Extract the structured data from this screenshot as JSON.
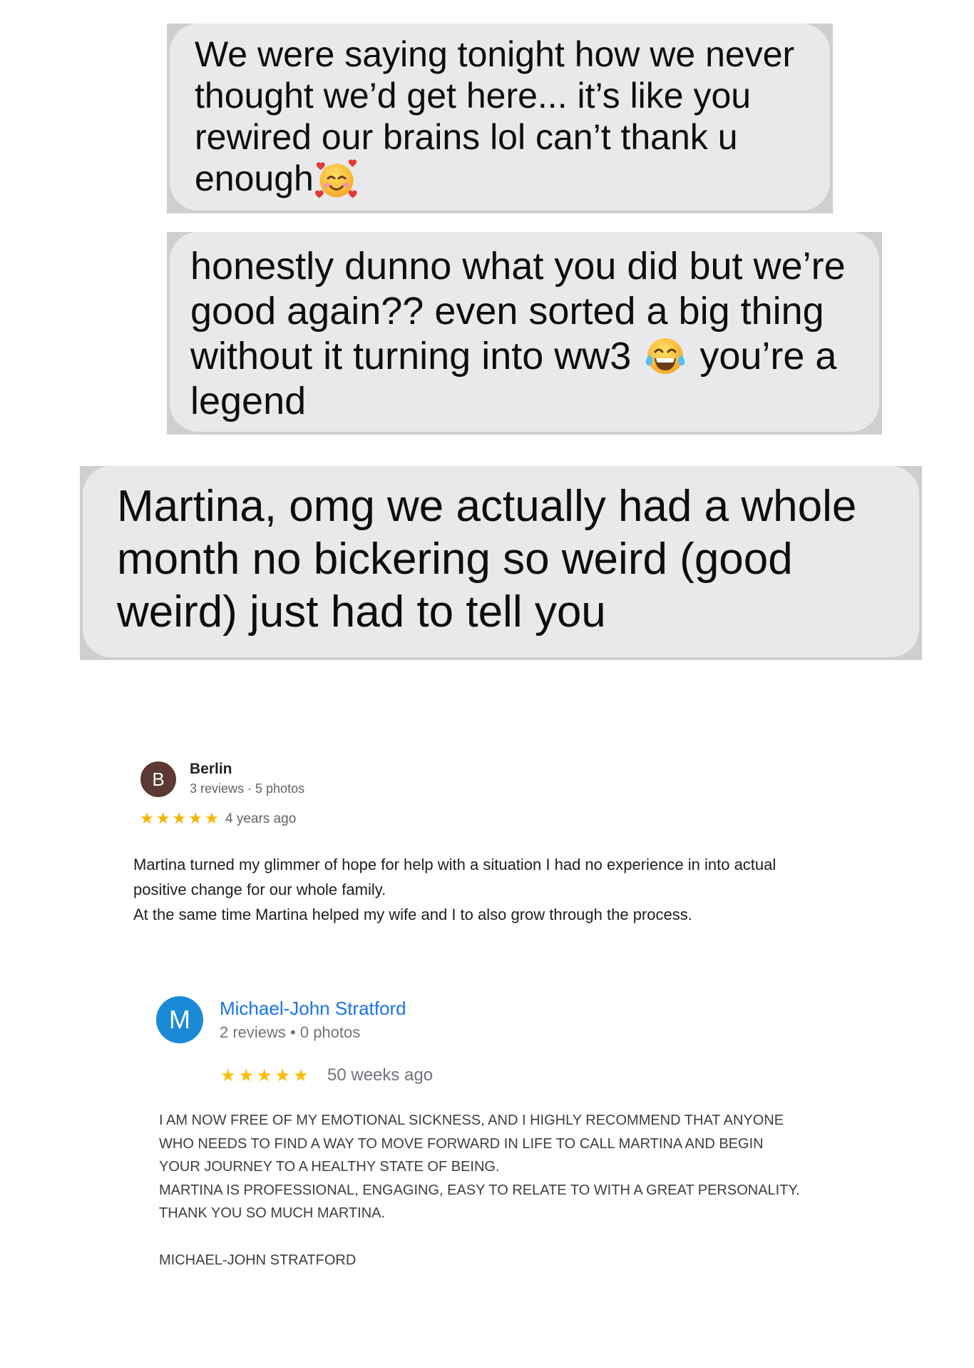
{
  "messages": [
    {
      "lines": [
        "We were saying tonight how we never",
        "thought we’d get here... it’s like you",
        "rewired our brains lol can’t thank u",
        "enough"
      ],
      "emoji_icon": "smiling-face-with-hearts-icon"
    },
    {
      "lines": [
        "honestly dunno what you did but we’re",
        "good again?? even sorted a big thing",
        {
          "before_emoji": "without it turning into ww3",
          "after_emoji": "you’re a"
        },
        "legend"
      ],
      "emoji_icon": "face-with-tears-of-joy-icon"
    },
    {
      "lines": [
        "Martina, omg we actually had a whole",
        "month no bickering so weird (good",
        "weird) just had to tell you"
      ]
    }
  ],
  "bubble_color": "#e9e9eb",
  "reviews": [
    {
      "avatar_letter": "B",
      "avatar_color": "#5b3a31",
      "name": "Berlin",
      "meta": "3 reviews · 5 photos",
      "rating": 5,
      "star_color": "#f4b400",
      "time": "4 years ago",
      "text": [
        "Martina turned my glimmer of hope for help with a situation I had no experience in into actual",
        "positive change for our whole family.",
        "At the same time Martina helped my wife and I to also grow through the process."
      ]
    },
    {
      "avatar_letter": "M",
      "avatar_color": "#1b8ad6",
      "name": "Michael-John Stratford",
      "name_color": "#1a73e8",
      "meta": "2 reviews • 0 photos",
      "rating": 5,
      "star_color": "#fbbc04",
      "time": "50 weeks ago",
      "text": [
        "I AM NOW FREE OF MY EMOTIONAL SICKNESS, AND I HIGHLY RECOMMEND THAT ANYONE",
        "WHO NEEDS TO FIND A WAY TO MOVE FORWARD IN LIFE TO CALL MARTINA AND BEGIN",
        "YOUR JOURNEY TO A HEALTHY STATE OF BEING.",
        "MARTINA IS PROFESSIONAL, ENGAGING, EASY TO RELATE TO WITH A GREAT PERSONALITY.",
        "THANK YOU SO MUCH MARTINA."
      ],
      "signature": "MICHAEL-JOHN STRATFORD"
    }
  ]
}
